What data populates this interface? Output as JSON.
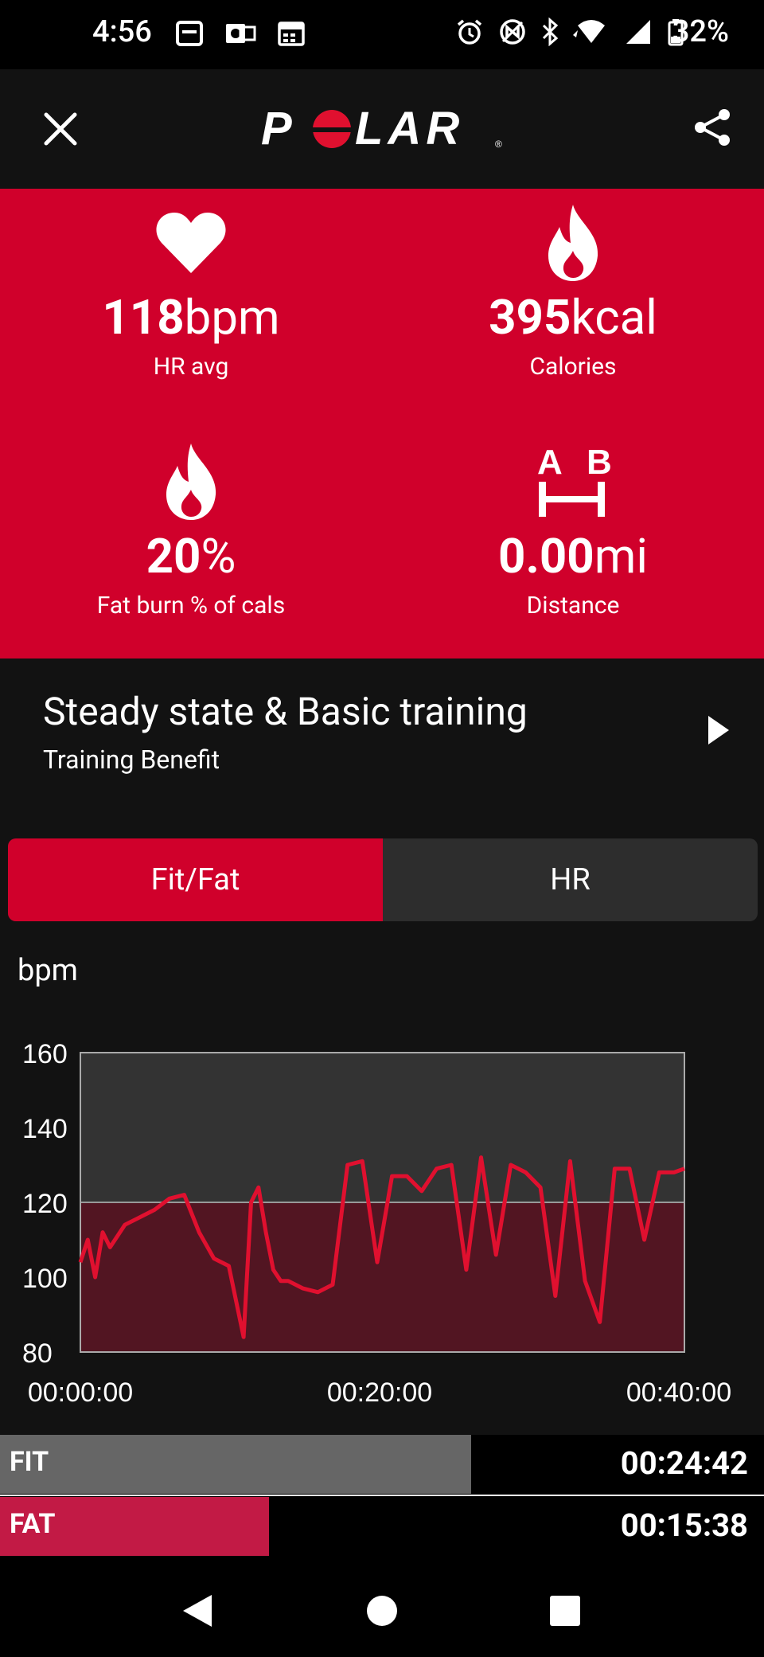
{
  "status_bar": {
    "time": "4:56",
    "battery": "32%"
  },
  "app_bar": {
    "logo_text": "POLAR"
  },
  "stats": [
    {
      "value": "118",
      "unit": "bpm",
      "label": "HR avg",
      "icon": "heart-icon"
    },
    {
      "value": "395",
      "unit": "kcal",
      "label": "Calories",
      "icon": "flame-icon"
    },
    {
      "value": "20",
      "unit": "%",
      "label": "Fat burn % of cals",
      "icon": "flame-icon"
    },
    {
      "value": "0.00",
      "unit": "mi",
      "label": "Distance",
      "icon": "distance-ab-icon",
      "icon_a": "A",
      "icon_b": "B"
    }
  ],
  "benefit": {
    "title": "Steady state & Basic training",
    "subtitle": "Training Benefit"
  },
  "tabs": [
    {
      "label": "Fit/Fat",
      "active": true
    },
    {
      "label": "HR",
      "active": false
    }
  ],
  "chart_data": {
    "type": "line",
    "ylabel": "bpm",
    "ylim": [
      80,
      160
    ],
    "yticks": [
      "160",
      "140",
      "120",
      "100",
      "80"
    ],
    "xticks": [
      "00:00:00",
      "00:20:00",
      "00:40:00"
    ],
    "threshold": 120,
    "x_minutes": [
      0,
      0.5,
      1,
      1.5,
      2,
      3,
      4,
      5,
      6,
      7,
      8,
      9,
      10,
      11,
      11.5,
      12,
      12.5,
      13,
      13.5,
      14,
      15,
      16,
      17,
      18,
      19,
      20,
      21,
      22,
      23,
      24,
      25,
      26,
      27,
      28,
      29,
      30,
      31,
      32,
      33,
      34,
      35,
      36,
      37,
      38,
      39,
      40,
      40.7
    ],
    "y_bpm": [
      104,
      110,
      100,
      112,
      108,
      114,
      116,
      118,
      121,
      122,
      112,
      105,
      103,
      84,
      120,
      124,
      112,
      102,
      99,
      99,
      97,
      96,
      98,
      130,
      131,
      104,
      127,
      127,
      123,
      129,
      130,
      102,
      132,
      106,
      130,
      128,
      124,
      95,
      131,
      99,
      88,
      129,
      129,
      110,
      128,
      128,
      129
    ],
    "line_color": "#e0102f",
    "above_fill": "#333333",
    "below_fill": "#521522"
  },
  "zones": [
    {
      "label": "FIT",
      "time": "00:24:42",
      "fraction": 0.617,
      "color": "#666666"
    },
    {
      "label": "FAT",
      "time": "00:15:38",
      "fraction": 0.391,
      "color": "#c21a45"
    }
  ]
}
